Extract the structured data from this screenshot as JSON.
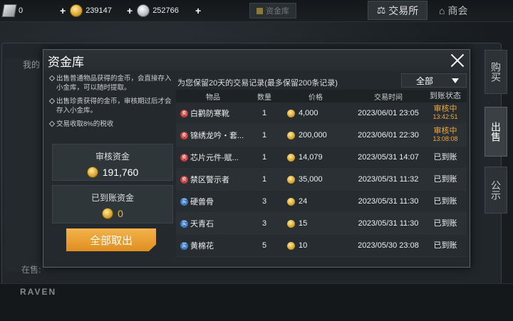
{
  "topbar": {
    "gem_value": "0",
    "gold_value": "239147",
    "silver_value": "252766",
    "mid_tab_label": "资金库",
    "trade_label": "交易所",
    "shop_label": "商会"
  },
  "background": {
    "my_label": "我的",
    "onsale_label": "在售:",
    "brand": "RAVEN",
    "side_tabs": [
      "购买",
      "出售",
      "公示"
    ]
  },
  "modal": {
    "title": "资金库",
    "notes": [
      "出售普通物品获得的金币，会直接存入小金库，可以随时提取。",
      "出售珍贵获得的金币，审核期过后才会存入小金库。",
      "交易收取8%的税收"
    ],
    "review_fund_label": "审核资金",
    "review_fund_value": "191,760",
    "arrived_fund_label": "已到账资金",
    "arrived_fund_value": "0",
    "withdraw_label": "全部取出",
    "hint": "为您保留20天的交易记录(最多保留200条记录)",
    "filter_value": "全部",
    "columns": [
      "物品",
      "数量",
      "价格",
      "交易时间",
      "到账状态"
    ],
    "rows": [
      {
        "tag": "卖",
        "type": "sell",
        "name": "白鹳防寒靴",
        "qty": "1",
        "price": "4,000",
        "time": "2023/06/01  23:05",
        "status": "审核中",
        "status_time": "13:42:51",
        "pending": true
      },
      {
        "tag": "卖",
        "type": "sell",
        "name": "锦绣龙吟・套...",
        "qty": "1",
        "price": "200,000",
        "time": "2023/06/01  22:30",
        "status": "审核中",
        "status_time": "13:08:08",
        "pending": true
      },
      {
        "tag": "卖",
        "type": "sell",
        "name": "芯片元件-赋...",
        "qty": "1",
        "price": "14,079",
        "time": "2023/05/31  14:07",
        "status": "已到账",
        "status_time": "",
        "pending": false
      },
      {
        "tag": "卖",
        "type": "sell",
        "name": "禁区警示者",
        "qty": "1",
        "price": "35,000",
        "time": "2023/05/31  11:32",
        "status": "已到账",
        "status_time": "",
        "pending": false
      },
      {
        "tag": "买",
        "type": "buy",
        "name": "硬兽骨",
        "qty": "3",
        "price": "24",
        "time": "2023/05/31  11:30",
        "status": "已到账",
        "status_time": "",
        "pending": false
      },
      {
        "tag": "买",
        "type": "buy",
        "name": "天青石",
        "qty": "3",
        "price": "15",
        "time": "2023/05/31  11:30",
        "status": "已到账",
        "status_time": "",
        "pending": false
      },
      {
        "tag": "买",
        "type": "buy",
        "name": "黄棉花",
        "qty": "5",
        "price": "10",
        "time": "2023/05/30  23:08",
        "status": "已到账",
        "status_time": "",
        "pending": false
      }
    ]
  },
  "colors": {
    "accent_orange": "#f0a93a",
    "sell_tag": "#c63a3a",
    "buy_tag": "#3a78c6",
    "button_orange": "#e99a2c"
  }
}
